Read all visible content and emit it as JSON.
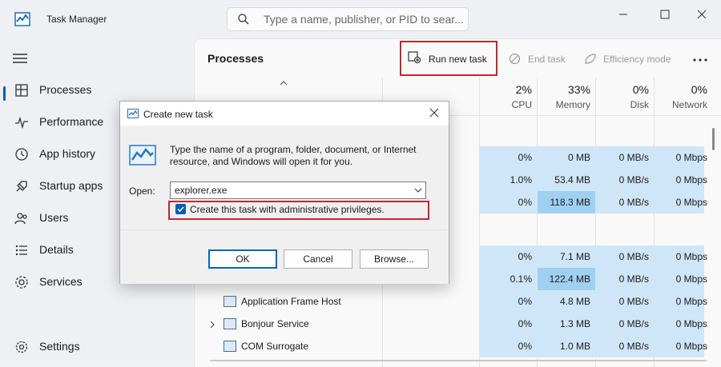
{
  "window": {
    "title": "Task Manager",
    "search_placeholder": "Type a name, publisher, or PID to sear..."
  },
  "sidebar": {
    "items": [
      {
        "label": "Processes",
        "icon": "processes-icon"
      },
      {
        "label": "Performance",
        "icon": "performance-icon"
      },
      {
        "label": "App history",
        "icon": "app-history-icon"
      },
      {
        "label": "Startup apps",
        "icon": "startup-apps-icon"
      },
      {
        "label": "Users",
        "icon": "users-icon"
      },
      {
        "label": "Details",
        "icon": "details-icon"
      },
      {
        "label": "Services",
        "icon": "services-icon"
      }
    ],
    "settings_label": "Settings"
  },
  "toolbar": {
    "page_title": "Processes",
    "run_new_task": "Run new task",
    "end_task": "End task",
    "efficiency_mode": "Efficiency mode"
  },
  "columns": [
    {
      "pct": "2%",
      "name": "CPU"
    },
    {
      "pct": "33%",
      "name": "Memory"
    },
    {
      "pct": "0%",
      "name": "Disk"
    },
    {
      "pct": "0%",
      "name": "Network"
    }
  ],
  "rows": [
    {
      "name": "",
      "cpu": "0%",
      "mem": "0 MB",
      "disk": "0 MB/s",
      "net": "0 Mbps"
    },
    {
      "name": "",
      "cpu": "1.0%",
      "mem": "53.4 MB",
      "disk": "0 MB/s",
      "net": "0 Mbps"
    },
    {
      "name": "",
      "cpu": "0%",
      "mem": "118.3 MB",
      "disk": "0 MB/s",
      "net": "0 Mbps"
    },
    {
      "name": "",
      "cpu": "0%",
      "mem": "7.1 MB",
      "disk": "0 MB/s",
      "net": "0 Mbps"
    },
    {
      "name": "",
      "cpu": "0.1%",
      "mem": "122.4 MB",
      "disk": "0 MB/s",
      "net": "0 Mbps"
    },
    {
      "name": "Application Frame Host",
      "cpu": "0%",
      "mem": "4.8 MB",
      "disk": "0 MB/s",
      "net": "0 Mbps"
    },
    {
      "name": "Bonjour Service",
      "cpu": "0%",
      "mem": "1.3 MB",
      "disk": "0 MB/s",
      "net": "0 Mbps"
    },
    {
      "name": "COM Surrogate",
      "cpu": "0%",
      "mem": "1.0 MB",
      "disk": "0 MB/s",
      "net": "0 Mbps"
    }
  ],
  "dialog": {
    "title": "Create new task",
    "message": "Type the name of a program, folder, document, or Internet resource, and Windows will open it for you.",
    "open_label": "Open:",
    "input_value": "explorer.exe",
    "admin_checkbox_label": "Create this task with administrative privileges.",
    "admin_checked": true,
    "ok": "OK",
    "cancel": "Cancel",
    "browse": "Browse..."
  },
  "colors": {
    "accent": "#005fb8",
    "highlight_outline": "#c0282e",
    "heat_light": "#cfe6f8",
    "heat_strong": "#9fd0f2"
  }
}
